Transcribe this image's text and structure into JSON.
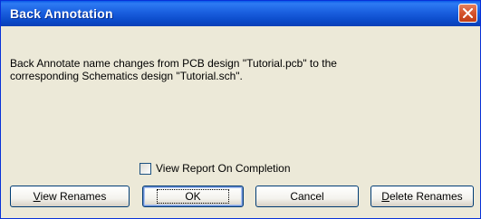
{
  "window": {
    "title": "Back Annotation"
  },
  "message": {
    "text": "Back Annotate name changes from PCB design \"Tutorial.pcb\" to the\ncorresponding Schematics design \"Tutorial.sch\"."
  },
  "options": {
    "view_report_label": "View Report On Completion",
    "view_report_checked": false
  },
  "buttons": {
    "view_renames": {
      "mnemonic": "V",
      "rest": "iew Renames"
    },
    "ok": "OK",
    "cancel": "Cancel",
    "delete_renames": {
      "mnemonic": "D",
      "rest": "elete Renames"
    }
  },
  "colors": {
    "titlebar": "#0A49C8",
    "dialog_bg": "#ECE9D8",
    "close_button": "#D5532B"
  }
}
